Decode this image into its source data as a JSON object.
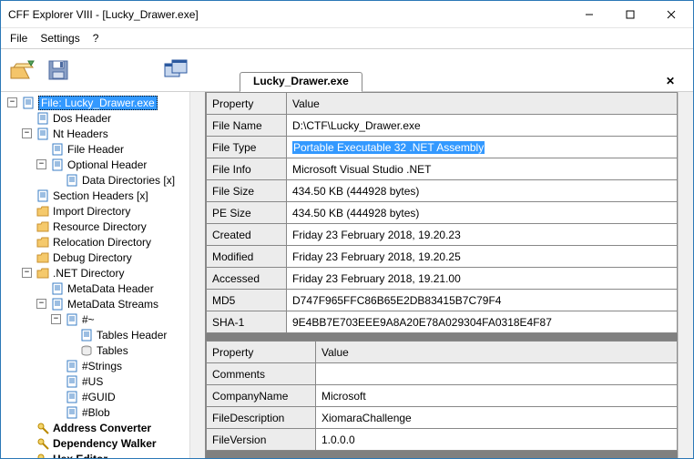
{
  "window": {
    "title": "CFF Explorer VIII - [Lucky_Drawer.exe]"
  },
  "menu": {
    "file": "File",
    "settings": "Settings",
    "help": "?"
  },
  "tab": {
    "label": "Lucky_Drawer.exe"
  },
  "tree": {
    "root": "File: Lucky_Drawer.exe",
    "items": [
      "Dos Header",
      "Nt Headers",
      "File Header",
      "Optional Header",
      "Data Directories [x]",
      "Section Headers [x]",
      "Import Directory",
      "Resource Directory",
      "Relocation Directory",
      "Debug Directory",
      ".NET Directory",
      "MetaData Header",
      "MetaData Streams",
      "#~",
      "Tables Header",
      "Tables",
      "#Strings",
      "#US",
      "#GUID",
      "#Blob",
      "Address Converter",
      "Dependency Walker",
      "Hex Editor"
    ]
  },
  "grid1": {
    "headers": {
      "prop": "Property",
      "val": "Value"
    },
    "rows": [
      {
        "p": "File Name",
        "v": "D:\\CTF\\Lucky_Drawer.exe"
      },
      {
        "p": "File Type",
        "v": "Portable Executable 32 .NET Assembly",
        "sel": true
      },
      {
        "p": "File Info",
        "v": "Microsoft Visual Studio .NET"
      },
      {
        "p": "File Size",
        "v": "434.50 KB (444928 bytes)"
      },
      {
        "p": "PE Size",
        "v": "434.50 KB (444928 bytes)"
      },
      {
        "p": "Created",
        "v": "Friday 23 February 2018, 19.20.23"
      },
      {
        "p": "Modified",
        "v": "Friday 23 February 2018, 19.20.25"
      },
      {
        "p": "Accessed",
        "v": "Friday 23 February 2018, 19.21.00"
      },
      {
        "p": "MD5",
        "v": "D747F965FFC86B65E2DB83415B7C79F4"
      },
      {
        "p": "SHA-1",
        "v": "9E4BB7E703EEE9A8A20E78A029304FA0318E4F87"
      }
    ]
  },
  "grid2": {
    "headers": {
      "prop": "Property",
      "val": "Value"
    },
    "rows": [
      {
        "p": "Comments",
        "v": ""
      },
      {
        "p": "CompanyName",
        "v": "Microsoft"
      },
      {
        "p": "FileDescription",
        "v": "XiomaraChallenge"
      },
      {
        "p": "FileVersion",
        "v": "1.0.0.0"
      }
    ]
  }
}
